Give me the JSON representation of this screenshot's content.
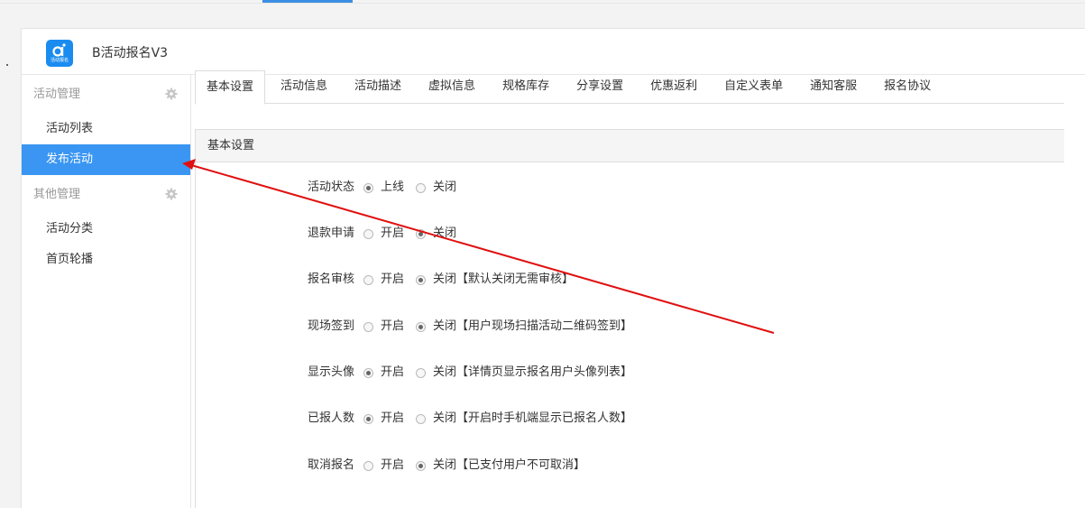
{
  "app": {
    "title": "B活动报名V3",
    "logo_text": "活动报名"
  },
  "sidebar": {
    "groups": [
      {
        "label": "活动管理",
        "items": [
          {
            "label": "活动列表",
            "active": false
          },
          {
            "label": "发布活动",
            "active": true
          }
        ]
      },
      {
        "label": "其他管理",
        "items": [
          {
            "label": "活动分类",
            "active": false
          },
          {
            "label": "首页轮播",
            "active": false
          }
        ]
      }
    ]
  },
  "tabs": [
    {
      "label": "基本设置",
      "active": true
    },
    {
      "label": "活动信息",
      "active": false
    },
    {
      "label": "活动描述",
      "active": false
    },
    {
      "label": "虚拟信息",
      "active": false
    },
    {
      "label": "规格库存",
      "active": false
    },
    {
      "label": "分享设置",
      "active": false
    },
    {
      "label": "优惠返利",
      "active": false
    },
    {
      "label": "自定义表单",
      "active": false
    },
    {
      "label": "通知客服",
      "active": false
    },
    {
      "label": "报名协议",
      "active": false
    }
  ],
  "panel": {
    "title": "基本设置",
    "rows": [
      {
        "label": "活动状态",
        "option_a": "上线",
        "option_b": "关闭",
        "selected": "a"
      },
      {
        "label": "退款申请",
        "option_a": "开启",
        "option_b": "关闭",
        "selected": "b"
      },
      {
        "label": "报名审核",
        "option_a": "开启",
        "option_b": "关闭【默认关闭无需审核】",
        "selected": "b"
      },
      {
        "label": "现场签到",
        "option_a": "开启",
        "option_b": "关闭【用户现场扫描活动二维码签到】",
        "selected": "b"
      },
      {
        "label": "显示头像",
        "option_a": "开启",
        "option_b": "关闭【详情页显示报名用户头像列表】",
        "selected": "a"
      },
      {
        "label": "已报人数",
        "option_a": "开启",
        "option_b": "关闭【开启时手机端显示已报名人数】",
        "selected": "a"
      },
      {
        "label": "取消报名",
        "option_a": "开启",
        "option_b": "关闭【已支付用户不可取消】",
        "selected": "b"
      }
    ]
  },
  "colors": {
    "accent": "#3a96f2",
    "annotation_arrow": "#e01010"
  }
}
